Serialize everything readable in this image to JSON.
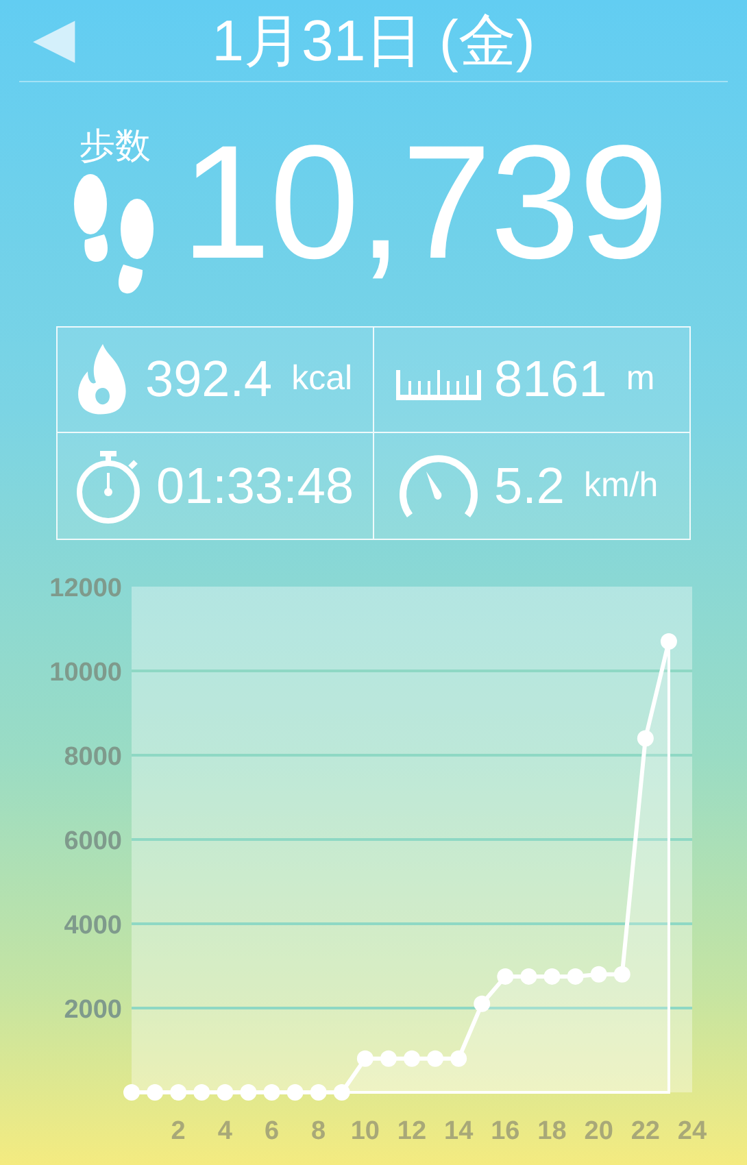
{
  "header": {
    "back_button": "◀",
    "title": "1月31日 (金)"
  },
  "steps": {
    "label": "歩数",
    "value": "10,739"
  },
  "stats": [
    {
      "kind": "calories",
      "value": "392.4",
      "unit": "kcal"
    },
    {
      "kind": "distance",
      "value": "8161",
      "unit": "m"
    },
    {
      "kind": "time",
      "value": "01:33:48"
    },
    {
      "kind": "speed",
      "value": "5.2",
      "unit": "km/h"
    }
  ],
  "chart": {
    "chart_data": {
      "type": "area",
      "x": [
        0,
        1,
        2,
        3,
        4,
        5,
        6,
        7,
        8,
        9,
        10,
        11,
        12,
        13,
        14,
        15,
        16,
        17,
        18,
        19,
        20,
        21,
        22,
        23
      ],
      "series": [
        {
          "color": "#ffffff",
          "values": [
            0,
            0,
            0,
            0,
            0,
            0,
            0,
            0,
            0,
            0,
            800,
            800,
            800,
            800,
            800,
            2100,
            2750,
            2750,
            2750,
            2750,
            2800,
            2800,
            8400,
            10700
          ]
        }
      ],
      "grid": true,
      "xlim": [
        0,
        24
      ],
      "ylim": [
        0,
        12000
      ],
      "xticks": [
        2,
        4,
        6,
        8,
        10,
        12,
        14,
        16,
        18,
        20,
        22,
        24
      ],
      "yticks": [
        2000,
        4000,
        6000,
        8000,
        10000,
        12000
      ]
    }
  }
}
